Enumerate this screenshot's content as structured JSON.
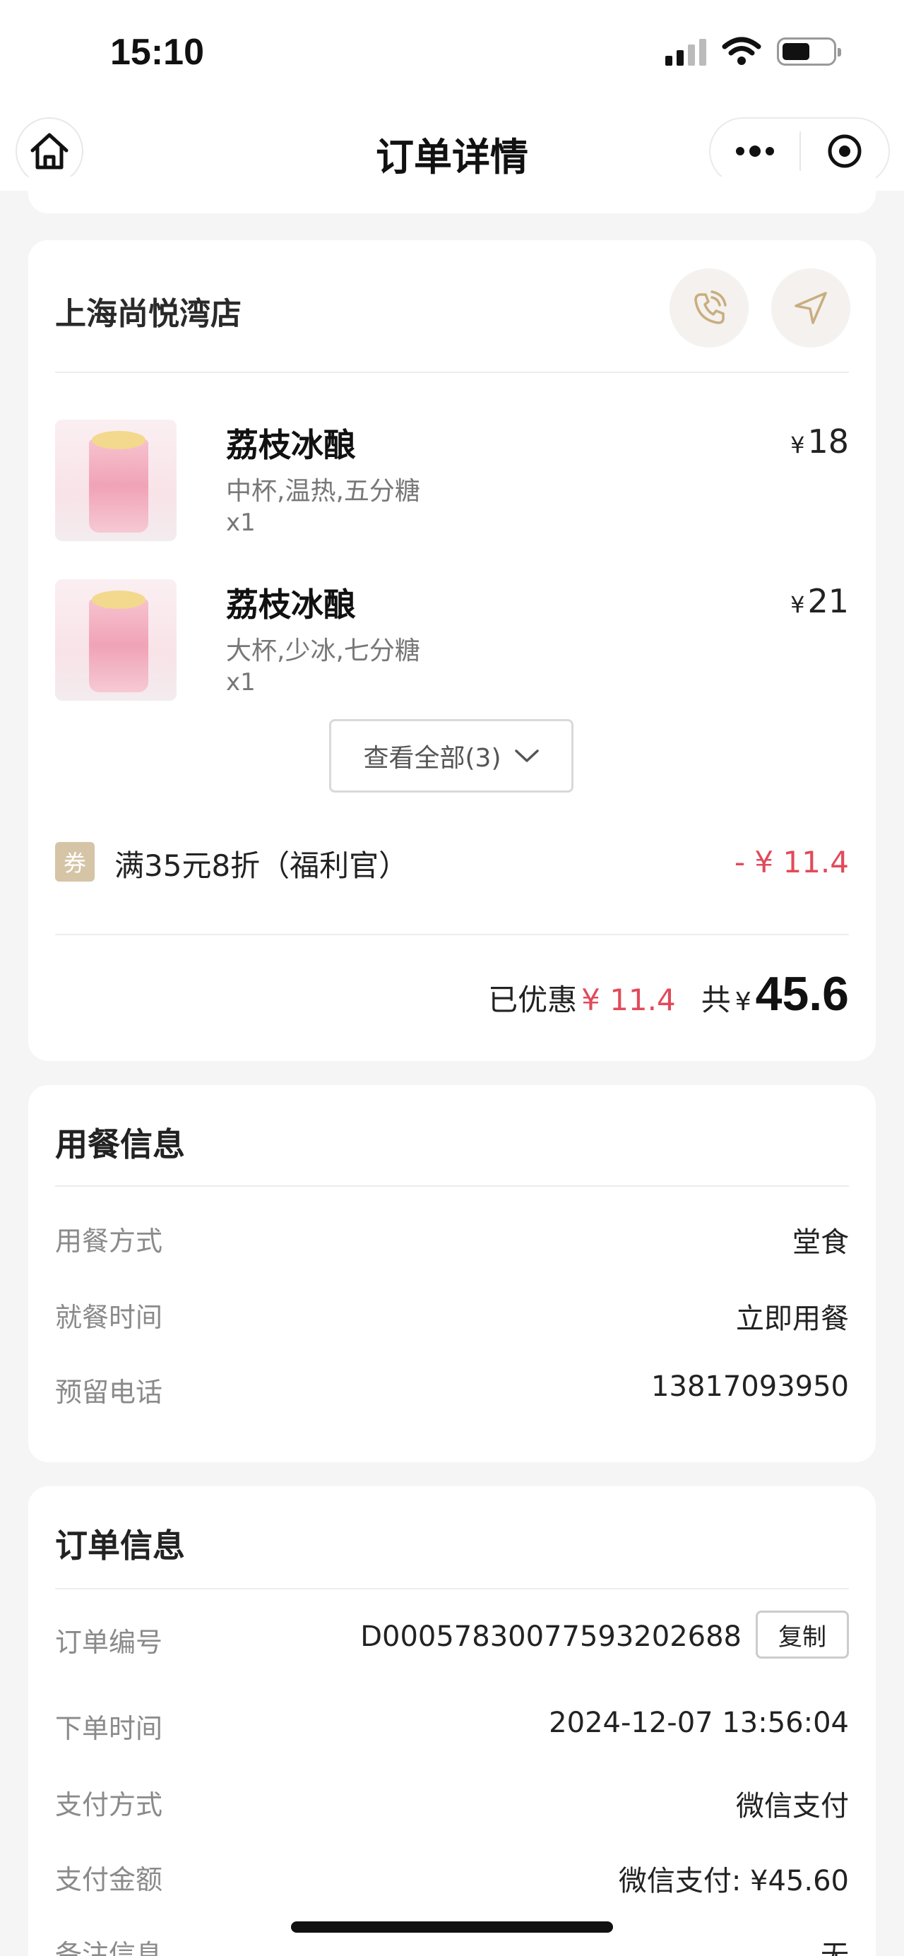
{
  "status_bar": {
    "time": "15:10"
  },
  "nav": {
    "title": "订单详情"
  },
  "store": {
    "name": "上海尚悦湾店",
    "items": [
      {
        "name": "荔枝冰酿",
        "spec": "中杯,温热,五分糖",
        "qty": "x1",
        "currency": "¥",
        "price": "18"
      },
      {
        "name": "荔枝冰酿",
        "spec": "大杯,少冰,七分糖",
        "qty": "x1",
        "currency": "¥",
        "price": "21"
      }
    ],
    "view_all_label": "查看全部(3)",
    "coupon_tag": "券",
    "coupon_text": "满35元8折（福利官）",
    "coupon_amount": "- ¥ 11.4",
    "summary": {
      "discount_label": "已优惠",
      "discount_value": "¥ 11.4",
      "total_label": "共",
      "currency": "¥",
      "total_value": "45.6"
    }
  },
  "dine_info": {
    "title": "用餐信息",
    "rows": [
      {
        "key": "用餐方式",
        "value": "堂食"
      },
      {
        "key": "就餐时间",
        "value": "立即用餐"
      },
      {
        "key": "预留电话",
        "value": "13817093950"
      }
    ]
  },
  "order_info": {
    "title": "订单信息",
    "order_no_label": "订单编号",
    "order_no": "D0005783007759320268​8",
    "copy_label": "复制",
    "rows": [
      {
        "key": "下单时间",
        "value": "2024-12-07 13:56:04"
      },
      {
        "key": "支付方式",
        "value": "微信支付"
      },
      {
        "key": "支付金额",
        "value": "微信支付: ¥45.60"
      },
      {
        "key": "备注信息",
        "value": "无"
      }
    ]
  },
  "colors": {
    "accent_red": "#e24a5a",
    "gold": "#d5c4a6",
    "background": "#f5f5f5"
  }
}
